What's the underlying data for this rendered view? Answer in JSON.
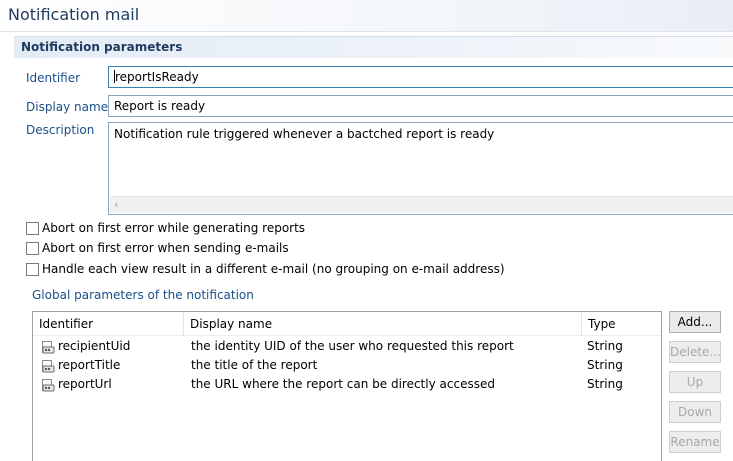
{
  "window": {
    "title": "Notification mail"
  },
  "section": {
    "title": "Notification parameters"
  },
  "fields": {
    "identifier": {
      "label": "Identifier",
      "value": "reportIsReady"
    },
    "display_name": {
      "label": "Display name",
      "value": "Report is ready"
    },
    "description": {
      "label": "Description",
      "value": "Notification rule triggered whenever a bactched report is ready"
    }
  },
  "checkboxes": [
    {
      "label": "Abort on first error while generating reports",
      "checked": false
    },
    {
      "label": "Abort on first error when sending e-mails",
      "checked": false
    },
    {
      "label": "Handle each view result in a different e-mail (no grouping on e-mail address)",
      "checked": false
    }
  ],
  "params": {
    "group_label": "Global parameters of the notification",
    "columns": [
      "Identifier",
      "Display name",
      "Type"
    ],
    "rows": [
      {
        "identifier": "recipientUid",
        "display_name": "the identity UID of the user who requested this report",
        "type": "String"
      },
      {
        "identifier": "reportTitle",
        "display_name": "the title of the report",
        "type": "String"
      },
      {
        "identifier": "reportUrl",
        "display_name": "the URL where the report can be directly accessed",
        "type": "String"
      }
    ],
    "buttons": {
      "add": "Add...",
      "delete": "Delete...",
      "up": "Up",
      "down": "Down",
      "rename": "Rename"
    }
  },
  "icons": {
    "param_row": "parameter-icon",
    "scroll_left": "chevron-left-icon"
  }
}
